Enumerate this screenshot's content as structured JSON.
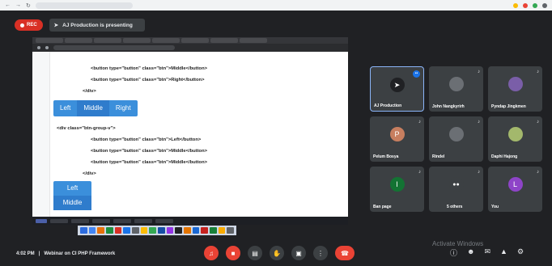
{
  "header": {
    "rec_label": "REC",
    "presenting_text": "AJ Production is presenting"
  },
  "shared_screen": {
    "code_lines": [
      "<button type=\"button\" class=\"btn\">Middle</button>",
      "<button type=\"button\" class=\"btn\">Right</button>",
      "</div>",
      "<div class=\"btn-group-v\">",
      "<button type=\"button\" class=\"btn\">Left</button>",
      "<button type=\"button\" class=\"btn\">Middle</button>",
      "<button type=\"button\" class=\"btn\">Middle</button>",
      "</div>"
    ],
    "btn_group_h": [
      "Left",
      "Middle",
      "Right"
    ],
    "btn_group_v": [
      "Left",
      "Middle"
    ]
  },
  "participants": [
    {
      "name": "AJ Production",
      "initial": "",
      "color": "#5f6368"
    },
    {
      "name": "John Nangkyrirh",
      "initial": "",
      "color": "#5f6368"
    },
    {
      "name": "Pyndap Jingkmen",
      "initial": "",
      "color": "#5f6368"
    },
    {
      "name": "Pelum Bosya",
      "initial": "P",
      "color": "#c77e5f"
    },
    {
      "name": "Rindel",
      "initial": "",
      "color": "#5f6368"
    },
    {
      "name": "Daphi Hajong",
      "initial": "",
      "color": "#5f6368"
    },
    {
      "name": "Ban page",
      "initial": "I",
      "color": "#137333"
    },
    {
      "name": "5 others",
      "initial": "",
      "color": "#5f6368"
    },
    {
      "name": "You",
      "initial": "L",
      "color": "#8e44c8"
    }
  ],
  "footer": {
    "time": "4:02 PM",
    "separator": "|",
    "meeting_title": "Webinar on CI PHP Framework",
    "watermark": "Activate Windows"
  },
  "colors": {
    "background": "#202124",
    "accent": "#1a73e8",
    "danger": "#ea4335",
    "button_blue": "#3b8fdb"
  }
}
